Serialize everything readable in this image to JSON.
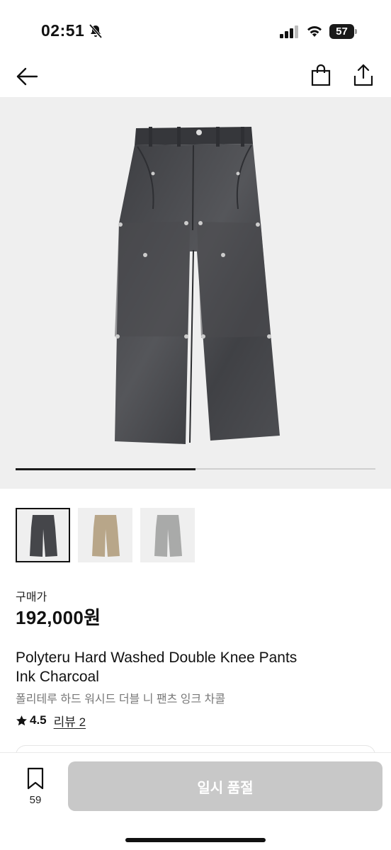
{
  "status_bar": {
    "time": "02:51",
    "battery_level": "57",
    "icons": [
      "bell-slash-icon",
      "cellular-signal-icon",
      "wifi-icon",
      "battery-icon"
    ]
  },
  "nav": {
    "icons": [
      "back-arrow-icon",
      "shopping-bag-icon",
      "share-icon"
    ]
  },
  "gallery": {
    "progress": 0.5,
    "main_color": "#4a4b4e",
    "thumbnails": [
      {
        "color": "#45464a",
        "selected": true
      },
      {
        "color": "#b8a689",
        "selected": false
      },
      {
        "color": "#a9aaa9",
        "selected": false
      }
    ]
  },
  "product": {
    "price_label": "구매가",
    "price": "192,000원",
    "title_en_line1": "Polyteru Hard Washed Double Knee Pants",
    "title_en_line2": "Ink Charcoal",
    "title_ko": "폴리테루 하드 워시드 더블 니 팬츠 잉크 차콜",
    "rating": "4.5",
    "review_link": "리뷰 2"
  },
  "bottom_bar": {
    "bookmark_count": "59",
    "soldout_label": "일시 품절",
    "button_color": "#c8c8c8"
  }
}
